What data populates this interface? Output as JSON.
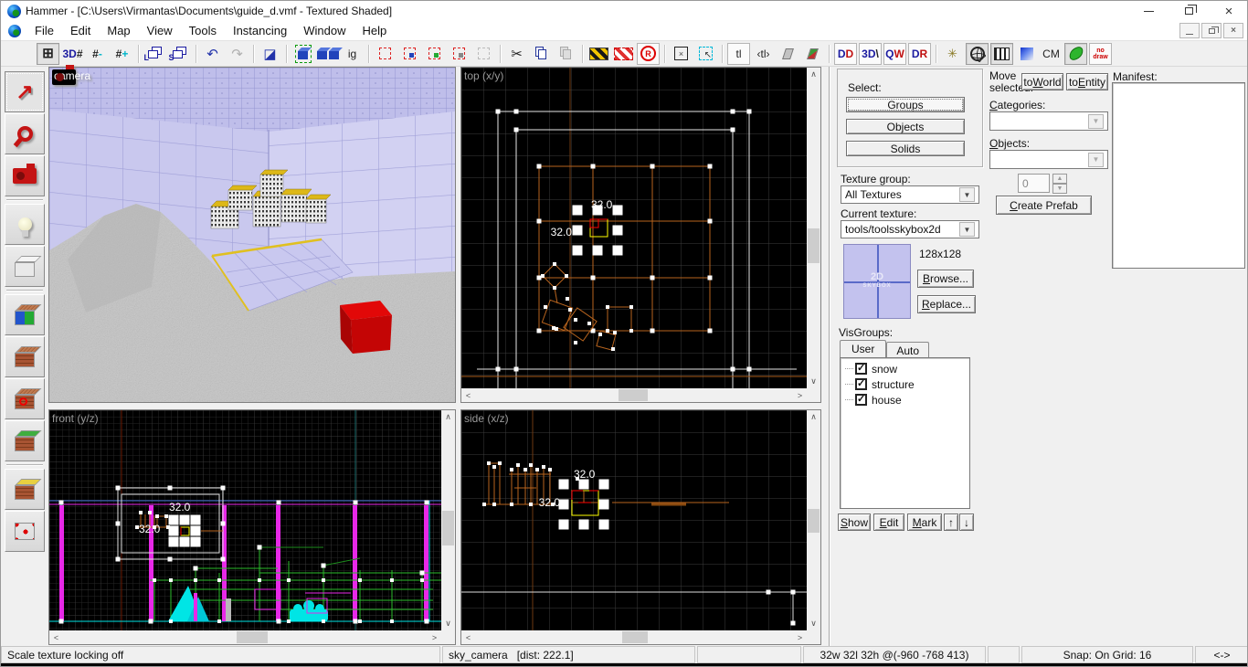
{
  "window": {
    "title": "Hammer - [C:\\Users\\Virmantas\\Documents\\guide_d.vmf - Textured Shaded]",
    "close_glyph": "×"
  },
  "mdi": {
    "close_glyph": "×"
  },
  "menu": {
    "items": [
      "File",
      "Edit",
      "Map",
      "View",
      "Tools",
      "Instancing",
      "Window",
      "Help"
    ]
  },
  "toolbar": {
    "snap_grid": "⊞",
    "grid_3d": {
      "a": "3D",
      "b": "#"
    },
    "grid_smaller": {
      "a": "#",
      "b": "-"
    },
    "grid_larger": {
      "a": "#",
      "b": "+"
    },
    "load_windows": "L",
    "save_windows": "S",
    "undo": "↶",
    "redo": "↷",
    "carve": "◪",
    "ig": "ig",
    "cut": "✂",
    "radius": "R",
    "marquee_x": "×",
    "cursor": "↖",
    "texture_lock": "tl",
    "texture_scale_lock": "‹tl›",
    "dd": {
      "a": "D",
      "b": "D"
    },
    "p3d": {
      "a": "3D",
      "b": "\\"
    },
    "qw": {
      "a": "Q",
      "b": "W"
    },
    "dr": {
      "a": "D",
      "b": "R"
    },
    "spark": "✳",
    "cm": "CM",
    "nodraw": "no\ndraw"
  },
  "viewports": {
    "camera": {
      "label": "camera"
    },
    "top": {
      "label": "top (x/y)",
      "measure_top": "32.0",
      "measure_left": "32.0"
    },
    "front": {
      "label": "front (y/z)",
      "measure_top": "32.0",
      "measure_left": "32.0"
    },
    "side": {
      "label": "side (x/z)",
      "measure_top": "32.0",
      "measure_left": "32.0"
    }
  },
  "scroll": {
    "up": "∧",
    "down": "∨",
    "left": "<",
    "right": ">"
  },
  "texture_preview": {
    "line1": "2D",
    "line2": "SKYBOX"
  },
  "object_bar": {
    "select_label": "Select:",
    "groups_btn": "Groups",
    "objects_btn": "Objects",
    "solids_btn": "Solids",
    "texture_group_label": "Texture group:",
    "texture_group_value": "All Textures",
    "current_texture_label": "Current texture:",
    "current_texture_value": "tools/toolsskybox2d",
    "texture_size": "128x128",
    "browse": {
      "pre": "",
      "key": "B",
      "post": "rowse..."
    },
    "replace": {
      "pre": "",
      "key": "R",
      "post": "eplace..."
    },
    "visgroups_label": "VisGroups:",
    "tab_user": "User",
    "tab_auto": "Auto",
    "check_glyph": "✓",
    "groups": [
      {
        "label": "snow"
      },
      {
        "label": "structure"
      },
      {
        "label": "house"
      }
    ],
    "show": {
      "pre": "",
      "key": "S",
      "post": "how"
    },
    "edit": {
      "pre": "",
      "key": "E",
      "post": "dit"
    },
    "mark": {
      "pre": "",
      "key": "M",
      "post": "ark"
    },
    "up_glyph": "↑",
    "down_glyph": "↓"
  },
  "prefab_bar": {
    "move_label_1": "Move",
    "move_label_2": "selected:",
    "to_world": {
      "pre": "to",
      "key": "W",
      "post": "orld"
    },
    "to_entity": {
      "pre": "to",
      "key": "E",
      "post": "ntity"
    },
    "categories": {
      "pre": "",
      "key": "C",
      "post": "ategories:"
    },
    "objects": {
      "pre": "",
      "key": "O",
      "post": "bjects:"
    },
    "spinner_value": "0",
    "create_prefab": {
      "pre": "",
      "key": "C",
      "post": "reate Prefab"
    },
    "manifest_label": "Manifest:"
  },
  "status_bar": {
    "segments": [
      "Scale texture locking off",
      "sky_camera   [dist: 222.1]",
      "",
      "32w 32l 32h @(-960 -768 413)",
      "",
      "Snap: On Grid: 16",
      "<->"
    ]
  },
  "colors": {
    "brush_orange": "#b8641e",
    "axis_orange": "#6e3a12",
    "selection_yellow": "#ffff00",
    "selection_red": "#ff0000",
    "magenta": "#e828e8",
    "cyan": "#00e5e5",
    "green": "#2dbd2d",
    "grid_gray": "#3c3c3c",
    "sky_lavender": "#cdccf0"
  }
}
